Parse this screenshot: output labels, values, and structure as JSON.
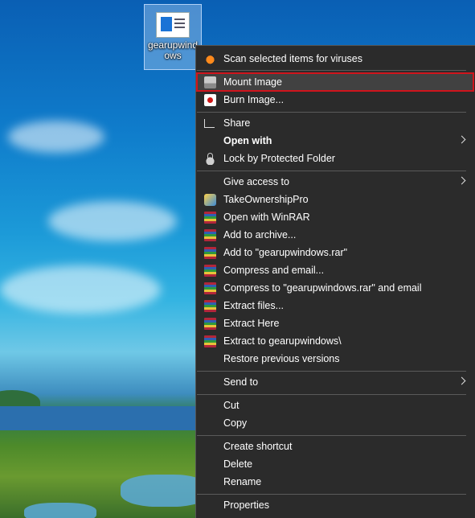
{
  "desktop": {
    "icon_label": "gearupwindows"
  },
  "context_menu": {
    "items": [
      {
        "label": "Scan selected items for viruses",
        "icon": "avast-icon"
      },
      {
        "label": "Mount Image",
        "icon": "disc-drive-icon",
        "highlighted": true
      },
      {
        "label": "Burn Image...",
        "icon": "burn-disc-icon"
      },
      {
        "label": "Share",
        "icon": "share-icon"
      },
      {
        "label": "Open with",
        "bold": true,
        "submenu": true
      },
      {
        "label": "Lock by Protected Folder",
        "icon": "lock-icon"
      },
      {
        "label": "Give access to",
        "submenu": true
      },
      {
        "label": "TakeOwnershipPro",
        "icon": "takeownership-icon"
      },
      {
        "label": "Open with WinRAR",
        "icon": "winrar-icon"
      },
      {
        "label": "Add to archive...",
        "icon": "winrar-icon"
      },
      {
        "label": "Add to \"gearupwindows.rar\"",
        "icon": "winrar-icon"
      },
      {
        "label": "Compress and email...",
        "icon": "winrar-icon"
      },
      {
        "label": "Compress to \"gearupwindows.rar\" and email",
        "icon": "winrar-icon"
      },
      {
        "label": "Extract files...",
        "icon": "winrar-icon"
      },
      {
        "label": "Extract Here",
        "icon": "winrar-icon"
      },
      {
        "label": "Extract to gearupwindows\\",
        "icon": "winrar-icon"
      },
      {
        "label": "Restore previous versions"
      },
      {
        "label": "Send to",
        "submenu": true
      },
      {
        "label": "Cut"
      },
      {
        "label": "Copy"
      },
      {
        "label": "Create shortcut"
      },
      {
        "label": "Delete"
      },
      {
        "label": "Rename"
      },
      {
        "label": "Properties"
      }
    ]
  },
  "colors": {
    "menu_bg": "#2b2b2b",
    "highlight_border": "#d0141c",
    "text": "#ffffff"
  }
}
